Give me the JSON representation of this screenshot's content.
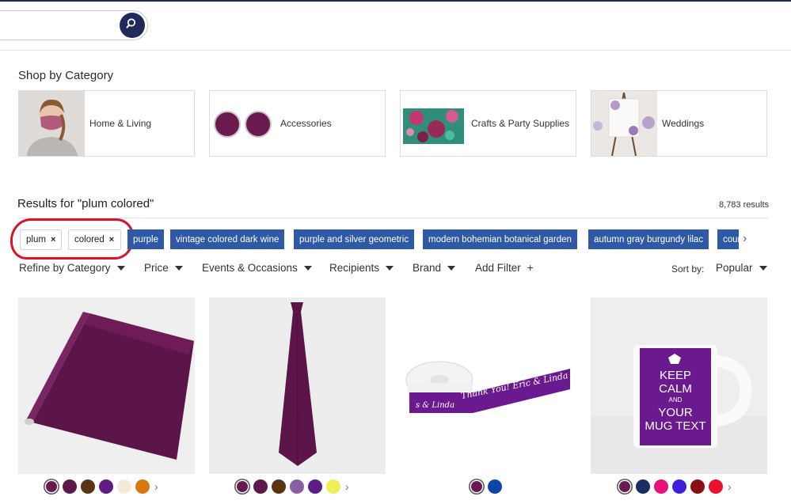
{
  "search": {
    "icon": "search-icon"
  },
  "categories": {
    "title": "Shop by Category",
    "items": [
      {
        "label": "Home & Living"
      },
      {
        "label": "Accessories"
      },
      {
        "label": "Crafts & Party Supplies"
      },
      {
        "label": "Weddings"
      }
    ]
  },
  "results": {
    "title": "Results for \"plum colored\"",
    "count": "8,783 results"
  },
  "chips": [
    {
      "label": "plum",
      "remove": "×"
    },
    {
      "label": "colored",
      "remove": "×"
    }
  ],
  "related_tags": [
    "purple",
    "vintage colored dark wine",
    "purple and silver geometric",
    "modern bohemian botanical garden",
    "autumn gray burgundy lilac",
    "country"
  ],
  "filters": {
    "refine": "Refine by Category",
    "price": "Price",
    "events": "Events & Occasions",
    "recipients": "Recipients",
    "brand": "Brand",
    "add_filter": "Add Filter",
    "add_symbol": "+",
    "sort_label": "Sort by:",
    "sort_value": "Popular"
  },
  "products": [
    {
      "swatches": [
        "#6b1a4f",
        "#5c1a4a",
        "#5a3510",
        "#5e1d86",
        "#f6ead7",
        "#d9780e"
      ],
      "selected": 0,
      "has_more": true
    },
    {
      "swatches": [
        "#6b1a4f",
        "#5c1a4a",
        "#5a3510",
        "#8a5ea2",
        "#5e1d86",
        "#efef59"
      ],
      "selected": 0,
      "has_more": true
    },
    {
      "swatches": [
        "#6b1a4f",
        "#0e46a8"
      ],
      "selected": 0,
      "has_more": false
    },
    {
      "swatches": [
        "#6b1a4f",
        "#1c2c63",
        "#e8117a",
        "#3f1fdf",
        "#8a0f12",
        "#e8102a"
      ],
      "selected": 0,
      "has_more": true
    }
  ],
  "ribbon_text": {
    "left": "s & Linda",
    "main": "Thank You! Eric & Linda"
  },
  "mug_text": {
    "line1": "KEEP",
    "line2": "CALM",
    "line3": "AND",
    "line4": "YOUR",
    "line5": "MUG TEXT"
  },
  "colors": {
    "accent": "#2e59a7",
    "search_button": "#1f2a5a",
    "highlight": "#d9142a",
    "plum": "#6b1a4f"
  }
}
